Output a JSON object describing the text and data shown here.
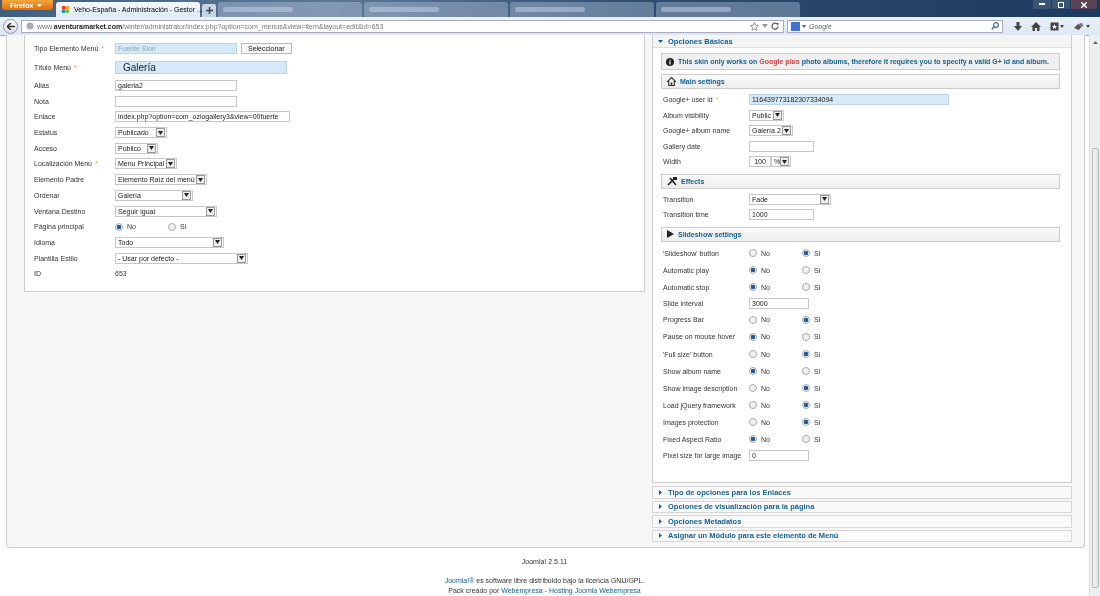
{
  "browser": {
    "menu_button": "Firefox",
    "tabs": [
      {
        "title": "Veho-España - Administración - Gestor ...",
        "selected": true
      },
      {
        "selected": false
      },
      {
        "selected": false
      },
      {
        "selected": false
      },
      {
        "selected": false
      }
    ],
    "url_prefix": "www.",
    "url_host": "aventuramarket.com",
    "url_path": "/winter/administrator/index.php?option=com_menus&view=item&layout=edit&id=653",
    "search_placeholder": "Google"
  },
  "details": {
    "fields": [
      {
        "kind": "input_button",
        "label": "Tipo Elemento Menú",
        "marker": "*",
        "value": "Fuente Slon",
        "highlighted": true,
        "button": "Seleccionar"
      },
      {
        "kind": "input",
        "label": "Título Menú",
        "marker": "*",
        "value": "Galería",
        "highlighted": true
      },
      {
        "kind": "input",
        "label": "Alias",
        "value": "galeria2",
        "highlighted": false
      },
      {
        "kind": "input",
        "label": "Nota",
        "highlighted": false
      },
      {
        "kind": "input",
        "label": "Enlace",
        "value": "index.php?option=com_oziogallery3&view=00fuerte",
        "highlighted": false
      },
      {
        "kind": "select",
        "label": "Estatus",
        "value": "Publicado"
      },
      {
        "kind": "select",
        "label": "Acceso",
        "value": "Público"
      },
      {
        "kind": "select",
        "label": "Localización Menú",
        "marker": "*",
        "value": "Menu Principal"
      },
      {
        "kind": "select",
        "label": "Elemento Padre",
        "value": "Elemento Raíz del menú"
      },
      {
        "kind": "select",
        "label": "Ordenar",
        "value": "Galería"
      },
      {
        "kind": "select",
        "label": "Ventana Destino",
        "value": "Seguir igual"
      },
      {
        "kind": "radio",
        "label": "Página principal",
        "options": [
          {
            "label": "No",
            "selected": true
          },
          {
            "label": "Si",
            "selected": false
          }
        ]
      },
      {
        "kind": "select",
        "label": "Idioma",
        "value": "Todo"
      },
      {
        "kind": "select",
        "label": "Plantilla Estilo",
        "value": "- Usar por defecto -"
      },
      {
        "kind": "text",
        "label": "ID",
        "value": "653"
      }
    ]
  },
  "basic_options": {
    "title": "Opciones Básicas",
    "expanded": true,
    "items": [
      {
        "kind": "info",
        "before": "This skin only works on ",
        "highlight": "Google plus",
        "after": " photo albums, therefore it requires you to specify a valid G+ id and album."
      },
      {
        "kind": "header",
        "title": "Main settings"
      },
      {
        "kind": "input",
        "label": "Google+ user id",
        "marker": "*",
        "value": "116439773182307334094",
        "highlighted": true
      },
      {
        "kind": "select",
        "label": "Album visibility",
        "value": "Public"
      },
      {
        "kind": "select",
        "label": "Google+ album name",
        "value": "Galería 2"
      },
      {
        "kind": "input",
        "label": "Gallery date",
        "highlighted": false
      },
      {
        "kind": "unit",
        "label": "Width",
        "value": "100",
        "unit": "%"
      },
      {
        "kind": "header",
        "title": "Effects"
      },
      {
        "kind": "select",
        "label": "Transition",
        "value": "Fade"
      },
      {
        "kind": "input",
        "label": "Transition time",
        "value": "1000",
        "highlighted": false
      },
      {
        "kind": "header",
        "title": "Slideshow settings"
      },
      {
        "kind": "radio",
        "label": "'Slideshow' button",
        "options": [
          {
            "label": "No",
            "selected": false
          },
          {
            "label": "Si",
            "selected": true
          }
        ]
      },
      {
        "kind": "radio",
        "label": "Automatic play",
        "options": [
          {
            "label": "No",
            "selected": true
          },
          {
            "label": "Si",
            "selected": false
          }
        ]
      },
      {
        "kind": "radio",
        "label": "Automatic stop",
        "options": [
          {
            "label": "No",
            "selected": true
          },
          {
            "label": "Si",
            "selected": false
          }
        ]
      },
      {
        "kind": "input",
        "label": "Slide interval",
        "value": "3000",
        "highlighted": false
      },
      {
        "kind": "radio",
        "label": "Progress Bar",
        "options": [
          {
            "label": "No",
            "selected": false
          },
          {
            "label": "Si",
            "selected": true
          }
        ]
      },
      {
        "kind": "radio",
        "label": "Pause on mouse hover",
        "options": [
          {
            "label": "No",
            "selected": true
          },
          {
            "label": "Si",
            "selected": false
          }
        ]
      },
      {
        "kind": "radio",
        "label": "'Full size' button",
        "options": [
          {
            "label": "No",
            "selected": false
          },
          {
            "label": "Si",
            "selected": true
          }
        ]
      },
      {
        "kind": "radio",
        "label": "Show album name",
        "options": [
          {
            "label": "No",
            "selected": true
          },
          {
            "label": "Si",
            "selected": false
          }
        ]
      },
      {
        "kind": "radio",
        "label": "Show image description",
        "options": [
          {
            "label": "No",
            "selected": false
          },
          {
            "label": "Si",
            "selected": true
          }
        ]
      },
      {
        "kind": "radio",
        "label": "Load jQuery framework",
        "options": [
          {
            "label": "No",
            "selected": false
          },
          {
            "label": "Si",
            "selected": true
          }
        ]
      },
      {
        "kind": "radio",
        "label": "Images protection",
        "options": [
          {
            "label": "No",
            "selected": false
          },
          {
            "label": "Si",
            "selected": true
          }
        ]
      },
      {
        "kind": "radio",
        "label": "Fixed Aspect Ratio",
        "options": [
          {
            "label": "No",
            "selected": true
          },
          {
            "label": "Si",
            "selected": false
          }
        ]
      },
      {
        "kind": "input",
        "label": "Pixel size for large image",
        "value": "0",
        "highlighted": false
      }
    ]
  },
  "accordion": [
    {
      "title": "Tipo de opciones para los Enlaces",
      "expanded": false
    },
    {
      "title": "Opciones de visualización para la página",
      "expanded": false
    },
    {
      "title": "Opciones Metadatos",
      "expanded": false
    },
    {
      "title": "Asignar un Módulo para este elemento de Menú",
      "expanded": false
    }
  ],
  "footer": {
    "version": "Joomla! 2.5.11",
    "license": {
      "link": "Joomla!®",
      "text": " es software libre distribuido bajo la licencia GNU/GPL."
    },
    "credits": {
      "prefix": "Pack creado por ",
      "links": [
        "Webempresa",
        "Hosting Joomla Webempresa"
      ],
      "separator": " - "
    }
  }
}
